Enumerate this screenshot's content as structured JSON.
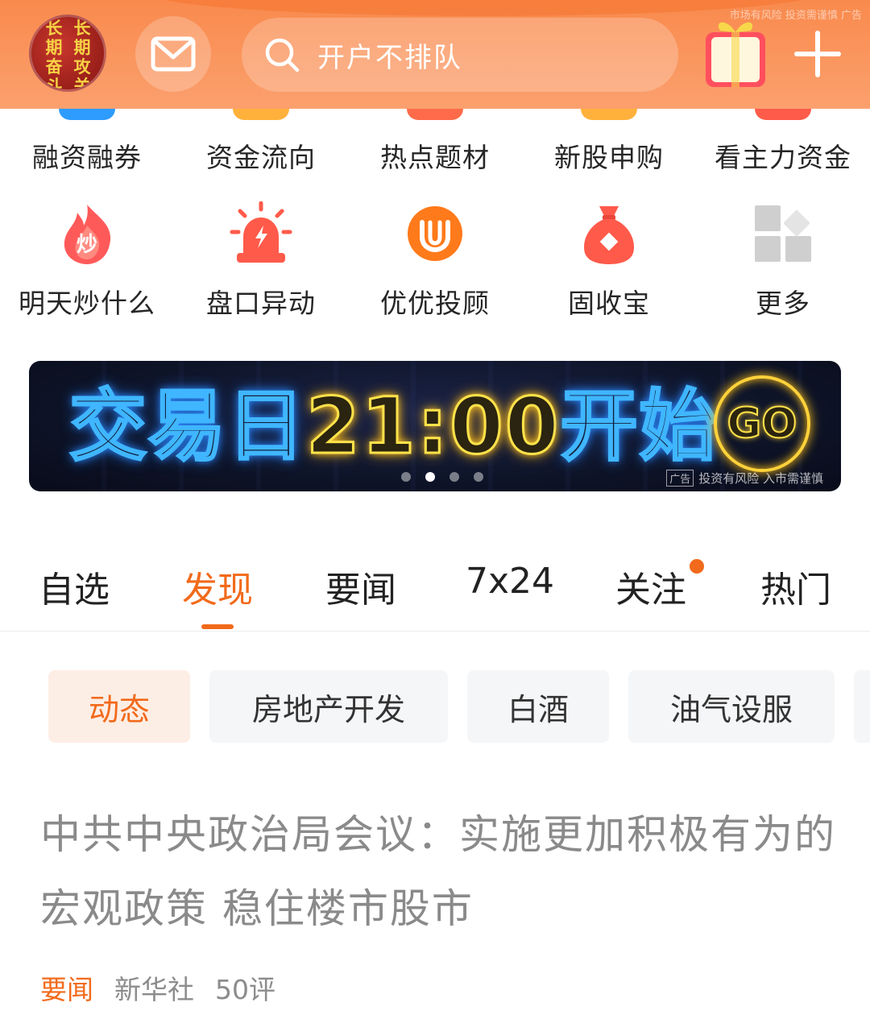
{
  "header": {
    "avatar_lines": [
      "长",
      "长",
      "期",
      "期",
      "奋",
      "攻",
      "斗",
      "关"
    ],
    "search_placeholder": "开户不排队",
    "top_disclaimer": "市场有风险 投资需谨慎",
    "top_ad_tag": "广告",
    "icons": [
      "avatar",
      "mail-icon",
      "search-icon",
      "gift-icon",
      "plus-icon"
    ]
  },
  "quick_grid": {
    "row1": [
      {
        "label": "融资融券",
        "color": "#2e9bff"
      },
      {
        "label": "资金流向",
        "color": "#ffb13b"
      },
      {
        "label": "热点题材",
        "color": "#ff6b4a"
      },
      {
        "label": "新股申购",
        "color": "#ffb13b"
      },
      {
        "label": "看主力资金",
        "color": "#ff5b4a"
      }
    ],
    "row2": [
      {
        "label": "明天炒什么",
        "icon": "flame-icon",
        "badge": "炒"
      },
      {
        "label": "盘口异动",
        "icon": "alarm-icon"
      },
      {
        "label": "优优投顾",
        "icon": "uu-logo-icon"
      },
      {
        "label": "固收宝",
        "icon": "money-bag-icon"
      },
      {
        "label": "更多",
        "icon": "more-grid-icon"
      }
    ]
  },
  "banner": {
    "text_blue_1": "交易日",
    "text_yellow": "21:00",
    "text_blue_2": "开始",
    "go": "GO",
    "ad_tag": "广告",
    "disclaimer": "投资有风险 入市需谨慎",
    "dots": 4,
    "active_dot": 1
  },
  "tabs": [
    {
      "label": "自选"
    },
    {
      "label": "发现",
      "active": true
    },
    {
      "label": "要闻"
    },
    {
      "label": "7x24"
    },
    {
      "label": "关注",
      "notify": true
    },
    {
      "label": "热门"
    }
  ],
  "chips": [
    {
      "label": "动态",
      "active": true
    },
    {
      "label": "房地产开发"
    },
    {
      "label": "白酒"
    },
    {
      "label": "油气设服"
    }
  ],
  "news": {
    "title": "中共中央政治局会议：实施更加积极有为的宏观政策 稳住楼市股市",
    "category": "要闻",
    "source": "新华社",
    "comments": "50评"
  },
  "colors": {
    "accent": "#f26a1b",
    "header_bg": "#f98a4d"
  }
}
